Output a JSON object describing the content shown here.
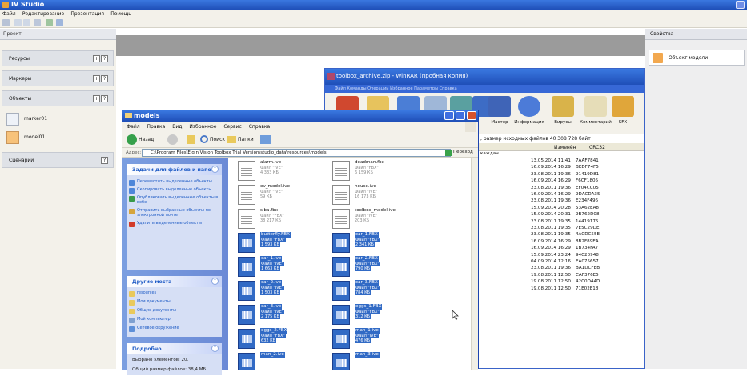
{
  "app": {
    "title": "IV Studio",
    "menu": [
      "Файл",
      "Редактирование",
      "Презентация",
      "Помощь"
    ]
  },
  "left_panel": {
    "header": "Проект",
    "sections": [
      {
        "label": "Ресурсы"
      },
      {
        "label": "Маркеры"
      },
      {
        "label": "Объекты"
      },
      {
        "label": "Сценарий"
      }
    ],
    "objects": [
      "marker01",
      "model01"
    ],
    "button_plus": "+",
    "button_help": "?"
  },
  "right_panel": {
    "header": "Свойства",
    "item": "Объект модели"
  },
  "winrar": {
    "title": "toolbox_archive.zip - WinRAR (пробная копия)",
    "menu": "Файл  Команды  Операции  Избранное  Параметры  Справка",
    "toolbar": [
      "Мастер",
      "Информация",
      "Вирусы",
      "Комментарий",
      "SFX"
    ],
    "info": ", размер исходных файлов 40 308 728 байт",
    "columns": {
      "modified": "Изменён",
      "crc": "CRC32"
    },
    "first_row": "каждан",
    "rows": [
      {
        "date": "13.05.2014 11:41",
        "crc": "7AAF7841"
      },
      {
        "date": "16.09.2014 16:29",
        "crc": "BEDF74F5"
      },
      {
        "date": "23.08.2011 19:36",
        "crc": "91419D81"
      },
      {
        "date": "16.09.2014 16:29",
        "crc": "F6CF1805"
      },
      {
        "date": "23.08.2011 19:36",
        "crc": "EF04CC05"
      },
      {
        "date": "16.09.2014 16:29",
        "crc": "9DACDA35"
      },
      {
        "date": "23.08.2011 19:36",
        "crc": "E234F496"
      },
      {
        "date": "15.09.2014 20:28",
        "crc": "53A62EA8"
      },
      {
        "date": "15.09.2014 20:31",
        "crc": "9B762D08"
      },
      {
        "date": "23.08.2011 19:35",
        "crc": "14419175"
      },
      {
        "date": "23.08.2011 19:35",
        "crc": "7E5C29DE"
      },
      {
        "date": "23.08.2011 19:35",
        "crc": "4ACDC55E"
      },
      {
        "date": "16.09.2014 16:29",
        "crc": "8B2F89EA"
      },
      {
        "date": "16.09.2014 16:29",
        "crc": "1B734FA7"
      },
      {
        "date": "15.09.2014 23:24",
        "crc": "94C20948"
      },
      {
        "date": "04.09.2014 12:16",
        "crc": "EA075657"
      },
      {
        "date": "23.08.2011 19:36",
        "crc": "BA1DCFEB"
      },
      {
        "date": "19.08.2011 12:50",
        "crc": "CAF376E5"
      },
      {
        "date": "19.08.2011 12:50",
        "crc": "42C0D44D"
      },
      {
        "date": "19.08.2011 12:50",
        "crc": "71E02E18"
      }
    ]
  },
  "explorer": {
    "title": "models",
    "menu": [
      "Файл",
      "Правка",
      "Вид",
      "Избранное",
      "Сервис",
      "Справка"
    ],
    "toolbar": {
      "back": "Назад",
      "search": "Поиск",
      "folders": "Папки"
    },
    "address_label": "Адрес:",
    "address": "C:\\Program Files\\Elgin Vision Toolbox Trial Version\\studio_data\\resources\\models",
    "go": "Переход",
    "tasks": {
      "header": "Задачи для файлов и папок",
      "items": [
        "Переместить выделенные объекты",
        "Скопировать выделенные объекты",
        "Опубликовать выделенные объекты в вебе",
        "Отправить выбранные объекты по электронной почте",
        "Удалить выделенные объекты"
      ]
    },
    "places": {
      "header": "Другие места",
      "items": [
        "resources",
        "Мои документы",
        "Общие документы",
        "Мой компьютер",
        "Сетевое окружение"
      ]
    },
    "details": {
      "header": "Подробно",
      "selected": "Выбрано элементов: 20.",
      "size": "Общий размер файлов: 38,4 МБ"
    },
    "files": [
      {
        "name": "alarm.ive",
        "type": "Файл \"IVE\"",
        "size": "4 333 КБ",
        "selected": false,
        "icon": "doc"
      },
      {
        "name": "deadman.fbx",
        "type": "Файл \"FBX\"",
        "size": "6 159 КБ",
        "selected": false,
        "icon": "doc"
      },
      {
        "name": "ev_model.ive",
        "type": "Файл \"IVE\"",
        "size": "59 КБ",
        "selected": false,
        "icon": "doc"
      },
      {
        "name": "house.ive",
        "type": "Файл \"IVE\"",
        "size": "16 173 КБ",
        "selected": false,
        "icon": "doc"
      },
      {
        "name": "siba.fbx",
        "type": "Файл \"FBX\"",
        "size": "38 217 КБ",
        "selected": false,
        "icon": "doc"
      },
      {
        "name": "toolbox_model.ive",
        "type": "Файл \"IVE\"",
        "size": "203 КБ",
        "selected": false,
        "icon": "doc"
      },
      {
        "name": "butterfly.FBX",
        "type": "Файл \"FBX\"",
        "size": "1 593 КБ",
        "selected": true,
        "icon": "grid"
      },
      {
        "name": "car_1.FBX",
        "type": "Файл \"FBX\"",
        "size": "2 341 КБ",
        "selected": true,
        "icon": "grid"
      },
      {
        "name": "car_1.ive",
        "type": "Файл \"IVE\"",
        "size": "1 663 КБ",
        "selected": true,
        "icon": "grid"
      },
      {
        "name": "car_2.FBX",
        "type": "Файл \"FBX\"",
        "size": "790 КБ",
        "selected": true,
        "icon": "grid"
      },
      {
        "name": "car_2.ive",
        "type": "Файл \"IVE\"",
        "size": "1 503 КБ",
        "selected": true,
        "icon": "grid"
      },
      {
        "name": "car_3.FBX",
        "type": "Файл \"FBX\"",
        "size": "784 КБ",
        "selected": true,
        "icon": "grid"
      },
      {
        "name": "car_3.ive",
        "type": "Файл \"IVE\"",
        "size": "2 175 КБ",
        "selected": true,
        "icon": "grid"
      },
      {
        "name": "eggs_1.FBX",
        "type": "Файл \"FBX\"",
        "size": "312 КБ",
        "selected": true,
        "icon": "grid"
      },
      {
        "name": "eggs_2.FBX",
        "type": "Файл \"FBX\"",
        "size": "632 КБ",
        "selected": true,
        "icon": "grid"
      },
      {
        "name": "man_1.ive",
        "type": "Файл \"IVE\"",
        "size": "476 КБ",
        "selected": true,
        "icon": "grid"
      },
      {
        "name": "man_2.ive",
        "type": "",
        "size": "",
        "selected": true,
        "icon": "grid"
      },
      {
        "name": "man_3.ive",
        "type": "",
        "size": "",
        "selected": true,
        "icon": "grid"
      }
    ]
  },
  "colors": {
    "xp_blue": "#2f62d6",
    "selection": "#316ac5",
    "task_link": "#215dc6"
  }
}
